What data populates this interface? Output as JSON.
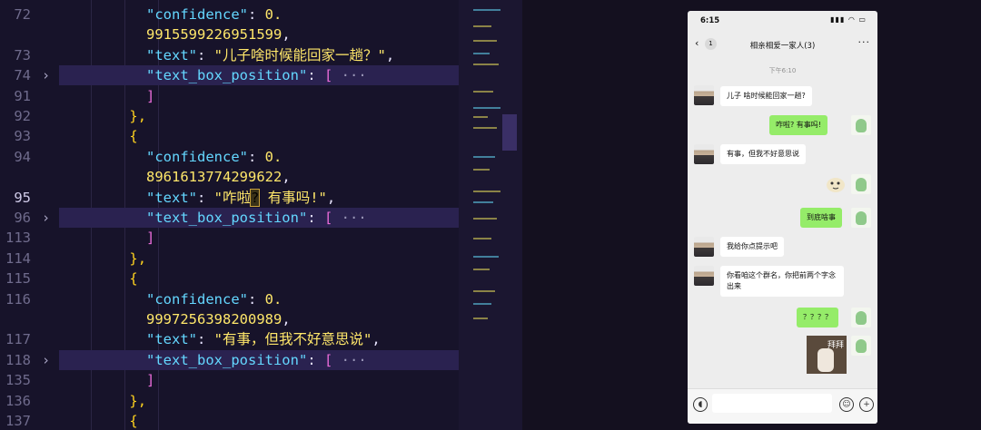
{
  "editor": {
    "lines": [
      {
        "num": "72",
        "active": false,
        "fold": false,
        "hl": false,
        "indent": 10,
        "parts": [
          [
            "k",
            "\"confidence\""
          ],
          [
            "p",
            ": "
          ],
          [
            "s",
            "0."
          ]
        ]
      },
      {
        "num": "",
        "active": false,
        "fold": false,
        "hl": false,
        "indent": 10,
        "parts": [
          [
            "s",
            "9915599226951599"
          ],
          [
            "p",
            ","
          ]
        ]
      },
      {
        "num": "73",
        "active": false,
        "fold": false,
        "hl": false,
        "indent": 10,
        "parts": [
          [
            "k",
            "\"text\""
          ],
          [
            "p",
            ": "
          ],
          [
            "s",
            "\"儿子啥时候能回家一趟？\""
          ],
          [
            "p",
            ","
          ]
        ]
      },
      {
        "num": "74",
        "active": false,
        "fold": true,
        "hl": true,
        "indent": 10,
        "parts": [
          [
            "k",
            "\"text_box_position\""
          ],
          [
            "p",
            ": "
          ],
          [
            "bm",
            "["
          ],
          [
            "ell",
            " ···"
          ]
        ]
      },
      {
        "num": "91",
        "active": false,
        "fold": false,
        "hl": false,
        "indent": 10,
        "parts": [
          [
            "bm",
            "]"
          ]
        ]
      },
      {
        "num": "92",
        "active": false,
        "fold": false,
        "hl": false,
        "indent": 8,
        "parts": [
          [
            "br",
            "},"
          ]
        ]
      },
      {
        "num": "93",
        "active": false,
        "fold": false,
        "hl": false,
        "indent": 8,
        "parts": [
          [
            "br",
            "{"
          ]
        ]
      },
      {
        "num": "94",
        "active": false,
        "fold": false,
        "hl": false,
        "indent": 10,
        "parts": [
          [
            "k",
            "\"confidence\""
          ],
          [
            "p",
            ": "
          ],
          [
            "s",
            "0."
          ]
        ]
      },
      {
        "num": "",
        "active": false,
        "fold": false,
        "hl": false,
        "indent": 10,
        "parts": [
          [
            "s",
            "8961613774299622"
          ],
          [
            "p",
            ","
          ]
        ]
      },
      {
        "num": "95",
        "active": true,
        "fold": false,
        "hl": false,
        "indent": 10,
        "parts": [
          [
            "k",
            "\"text\""
          ],
          [
            "p",
            ": "
          ],
          [
            "s",
            "\"咋啦"
          ],
          [
            "caret",
            "?"
          ],
          [
            "s",
            " 有事吗!\""
          ],
          [
            "p",
            ","
          ]
        ]
      },
      {
        "num": "96",
        "active": false,
        "fold": true,
        "hl": true,
        "indent": 10,
        "parts": [
          [
            "k",
            "\"text_box_position\""
          ],
          [
            "p",
            ": "
          ],
          [
            "bm",
            "["
          ],
          [
            "ell",
            " ···"
          ]
        ]
      },
      {
        "num": "113",
        "active": false,
        "fold": false,
        "hl": false,
        "indent": 10,
        "parts": [
          [
            "bm",
            "]"
          ]
        ]
      },
      {
        "num": "114",
        "active": false,
        "fold": false,
        "hl": false,
        "indent": 8,
        "parts": [
          [
            "br",
            "},"
          ]
        ]
      },
      {
        "num": "115",
        "active": false,
        "fold": false,
        "hl": false,
        "indent": 8,
        "parts": [
          [
            "br",
            "{"
          ]
        ]
      },
      {
        "num": "116",
        "active": false,
        "fold": false,
        "hl": false,
        "indent": 10,
        "parts": [
          [
            "k",
            "\"confidence\""
          ],
          [
            "p",
            ": "
          ],
          [
            "s",
            "0."
          ]
        ]
      },
      {
        "num": "",
        "active": false,
        "fold": false,
        "hl": false,
        "indent": 10,
        "parts": [
          [
            "s",
            "9997256398200989"
          ],
          [
            "p",
            ","
          ]
        ]
      },
      {
        "num": "117",
        "active": false,
        "fold": false,
        "hl": false,
        "indent": 10,
        "parts": [
          [
            "k",
            "\"text\""
          ],
          [
            "p",
            ": "
          ],
          [
            "s",
            "\"有事，但我不好意思说\""
          ],
          [
            "p",
            ","
          ]
        ]
      },
      {
        "num": "118",
        "active": false,
        "fold": true,
        "hl": true,
        "indent": 10,
        "parts": [
          [
            "k",
            "\"text_box_position\""
          ],
          [
            "p",
            ": "
          ],
          [
            "bm",
            "["
          ],
          [
            "ell",
            " ···"
          ]
        ]
      },
      {
        "num": "135",
        "active": false,
        "fold": false,
        "hl": false,
        "indent": 10,
        "parts": [
          [
            "bm",
            "]"
          ]
        ]
      },
      {
        "num": "136",
        "active": false,
        "fold": false,
        "hl": false,
        "indent": 8,
        "parts": [
          [
            "br",
            "},"
          ]
        ]
      },
      {
        "num": "137",
        "active": false,
        "fold": false,
        "hl": false,
        "indent": 8,
        "parts": [
          [
            "br",
            "{"
          ]
        ]
      }
    ],
    "fold_icon": "chevron-right-icon"
  },
  "phone": {
    "status": {
      "time": "6:15",
      "icons": "▮▮▮ ◠ ▭"
    },
    "nav": {
      "back_icon": "chevron-left-icon",
      "unread": "1",
      "title": "相亲相爱一家人(3)",
      "more": "···"
    },
    "timestamp": "下午6:10",
    "messages": [
      {
        "side": "in",
        "text": "儿子 啥时候能回家一趟?"
      },
      {
        "side": "out",
        "text": "咋啦? 有事吗!"
      },
      {
        "side": "in",
        "text": "有事，但我不好意思说"
      },
      {
        "side": "out",
        "text": "",
        "sticker": "cute-sticker"
      },
      {
        "side": "out",
        "text": "到底啥事"
      },
      {
        "side": "in",
        "text": "我给你点提示吧"
      },
      {
        "side": "in",
        "text": "你看咱这个群名，你把前两个字念出来"
      },
      {
        "side": "out",
        "text": "？？？？"
      },
      {
        "side": "out",
        "text": "拜拜",
        "sticker": "bye-sticker"
      }
    ],
    "input": {
      "voice_icon": "voice-icon",
      "emoji_icon": "emoji-icon",
      "plus_icon": "plus-icon"
    }
  }
}
